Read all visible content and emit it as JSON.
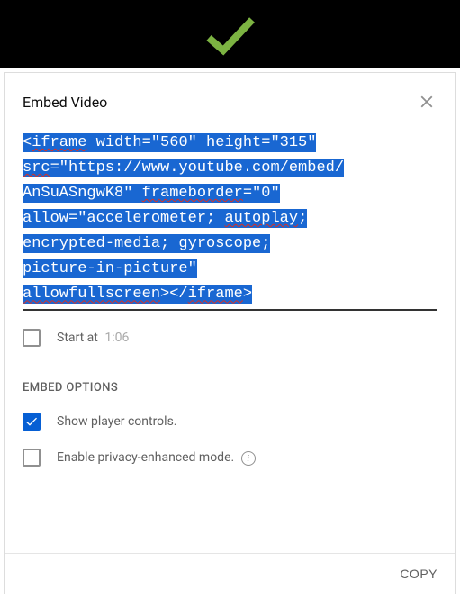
{
  "banner": {
    "check_color": "#7cb342"
  },
  "dialog": {
    "title": "Embed Video",
    "embed_code": "<iframe width=\"560\" height=\"315\" src=\"https://www.youtube.com/embed/AnSuASngwK8\" frameborder=\"0\" allow=\"accelerometer; autoplay; encrypted-media; gyroscope; picture-in-picture\" allowfullscreen></iframe>",
    "start_at": {
      "label": "Start at",
      "time": "1:06",
      "checked": false
    },
    "section_heading": "EMBED OPTIONS",
    "options": [
      {
        "label": "Show player controls.",
        "checked": true,
        "info": false
      },
      {
        "label": "Enable privacy-enhanced mode.",
        "checked": false,
        "info": true
      }
    ],
    "copy_label": "COPY"
  }
}
